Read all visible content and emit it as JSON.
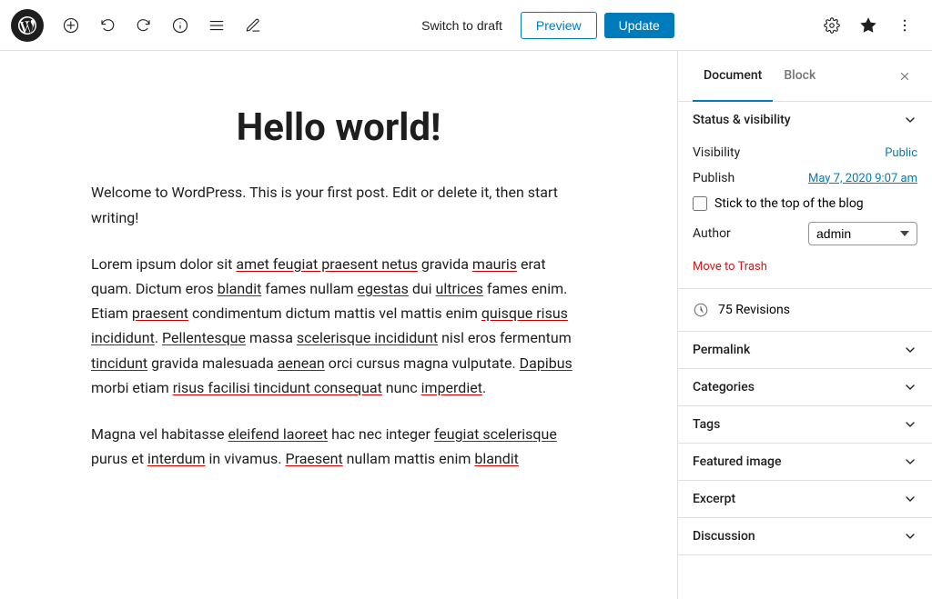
{
  "toolbar": {
    "logo_aria": "WordPress",
    "add_label": "Add",
    "undo_label": "Undo",
    "redo_label": "Redo",
    "info_label": "Document overview",
    "list_view_label": "List view",
    "tools_label": "Tools",
    "switch_draft_label": "Switch to draft",
    "preview_label": "Preview",
    "update_label": "Update",
    "settings_label": "Settings",
    "pin_label": "Pin",
    "more_label": "More"
  },
  "sidebar": {
    "tab_document": "Document",
    "tab_block": "Block",
    "close_label": "Close",
    "sections": {
      "status_visibility": {
        "title": "Status & visibility",
        "visibility_label": "Visibility",
        "visibility_value": "Public",
        "publish_label": "Publish",
        "publish_value": "May 7, 2020 9:07 am",
        "stick_label": "Stick to the top of the blog",
        "author_label": "Author",
        "author_value": "admin",
        "move_to_trash": "Move to Trash"
      },
      "revisions": {
        "label": "75 Revisions"
      },
      "permalink": {
        "title": "Permalink"
      },
      "categories": {
        "title": "Categories"
      },
      "tags": {
        "title": "Tags"
      },
      "featured_image": {
        "title": "Featured image"
      },
      "excerpt": {
        "title": "Excerpt"
      },
      "discussion": {
        "title": "Discussion"
      }
    }
  },
  "editor": {
    "title": "Hello world!",
    "paragraphs": [
      "Welcome to WordPress. This is your first post. Edit or delete it, then start writing!",
      "Lorem ipsum dolor sit amet feugiat praesent netus gravida mauris erat quam. Dictum eros blandit fames nullam egestas dui ultrices fames enim. Etiam praesent condimentum dictum mattis vel mattis enim quisque risus incididunt. Pellentesque massa scelerisque incididunt nisl eros fermentum tincidunt gravida malesuada aenean orci cursus magna vulputate. Dapibus morbi etiam risus facilisi tincidunt consequat nunc imperdiet.",
      "Magna vel habitasse eleifend laoreet hac nec integer feugiat scelerisque purus et interdum in vivamus. Praesent nullam mattis enim blandit..."
    ]
  }
}
